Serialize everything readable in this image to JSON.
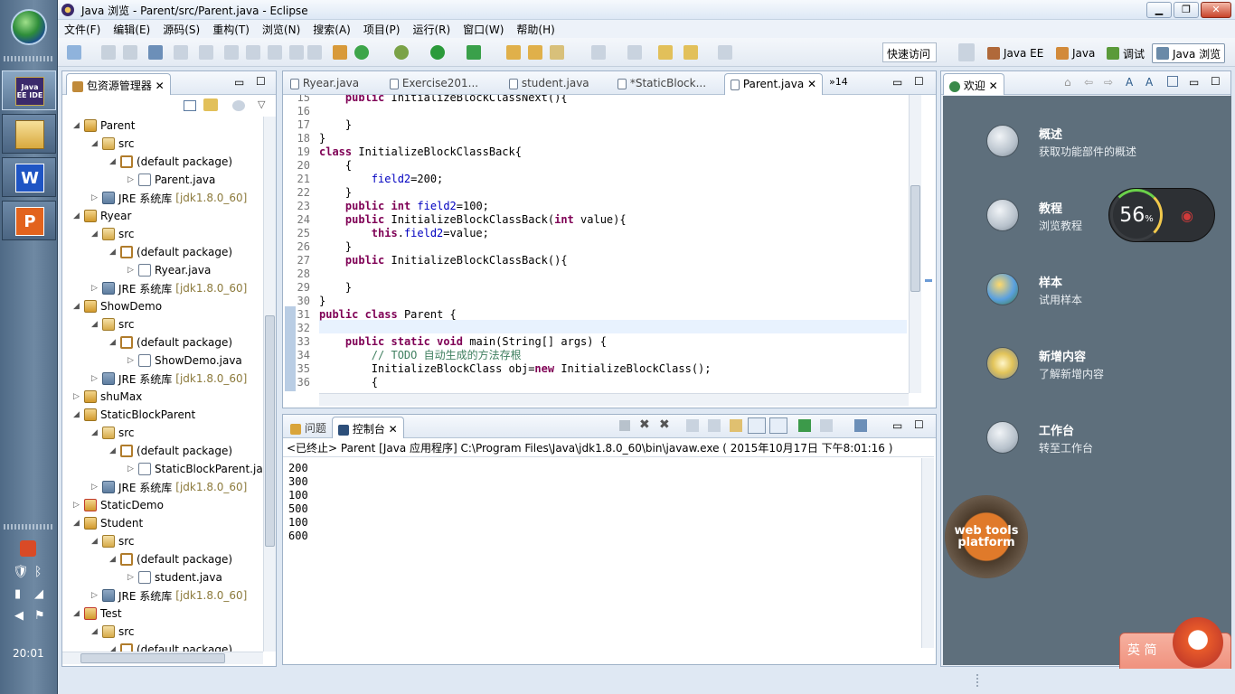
{
  "window": {
    "title": "Java 浏览 - Parent/src/Parent.java - Eclipse"
  },
  "taskbar": {
    "apps": [
      {
        "label": "Java EE IDE",
        "icon": "eclipse-icon"
      },
      {
        "label": "",
        "icon": "folder-icon"
      },
      {
        "label": "W",
        "icon": "wps-writer-icon"
      },
      {
        "label": "P",
        "icon": "wps-presentation-icon"
      }
    ],
    "clock": "20:01"
  },
  "menu": [
    "文件(F)",
    "编辑(E)",
    "源码(S)",
    "重构(T)",
    "浏览(N)",
    "搜索(A)",
    "项目(P)",
    "运行(R)",
    "窗口(W)",
    "帮助(H)"
  ],
  "quick_access": "快速访问",
  "perspectives": [
    "Java EE",
    "Java",
    "调试",
    "Java 浏览"
  ],
  "package_explorer": {
    "title": "包资源管理器",
    "rows": [
      {
        "indent": 0,
        "twisty": "◢",
        "icon": "proj",
        "label": "Parent"
      },
      {
        "indent": 1,
        "twisty": "◢",
        "icon": "src",
        "label": "src"
      },
      {
        "indent": 2,
        "twisty": "◢",
        "icon": "pkg",
        "label": "(default package)"
      },
      {
        "indent": 3,
        "twisty": "▷",
        "icon": "jfile",
        "label": "Parent.java"
      },
      {
        "indent": 1,
        "twisty": "▷",
        "icon": "jre",
        "label": "JRE 系统库",
        "ver": "[jdk1.8.0_60]"
      },
      {
        "indent": 0,
        "twisty": "◢",
        "icon": "proj",
        "label": "Ryear"
      },
      {
        "indent": 1,
        "twisty": "◢",
        "icon": "src",
        "label": "src"
      },
      {
        "indent": 2,
        "twisty": "◢",
        "icon": "pkg",
        "label": "(default package)"
      },
      {
        "indent": 3,
        "twisty": "▷",
        "icon": "jfile",
        "label": "Ryear.java"
      },
      {
        "indent": 1,
        "twisty": "▷",
        "icon": "jre",
        "label": "JRE 系统库",
        "ver": "[jdk1.8.0_60]"
      },
      {
        "indent": 0,
        "twisty": "◢",
        "icon": "proj",
        "label": "ShowDemo"
      },
      {
        "indent": 1,
        "twisty": "◢",
        "icon": "src",
        "label": "src"
      },
      {
        "indent": 2,
        "twisty": "◢",
        "icon": "pkg",
        "label": "(default package)"
      },
      {
        "indent": 3,
        "twisty": "▷",
        "icon": "jfile",
        "label": "ShowDemo.java"
      },
      {
        "indent": 1,
        "twisty": "▷",
        "icon": "jre",
        "label": "JRE 系统库",
        "ver": "[jdk1.8.0_60]"
      },
      {
        "indent": 0,
        "twisty": "▷",
        "icon": "proj",
        "label": "shuMax"
      },
      {
        "indent": 0,
        "twisty": "◢",
        "icon": "proj",
        "label": "StaticBlockParent"
      },
      {
        "indent": 1,
        "twisty": "◢",
        "icon": "src",
        "label": "src"
      },
      {
        "indent": 2,
        "twisty": "◢",
        "icon": "pkg",
        "label": "(default package)"
      },
      {
        "indent": 3,
        "twisty": "▷",
        "icon": "jfile",
        "label": "StaticBlockParent.jav"
      },
      {
        "indent": 1,
        "twisty": "▷",
        "icon": "jre",
        "label": "JRE 系统库",
        "ver": "[jdk1.8.0_60]"
      },
      {
        "indent": 0,
        "twisty": "▷",
        "icon": "err",
        "label": "StaticDemo"
      },
      {
        "indent": 0,
        "twisty": "◢",
        "icon": "proj",
        "label": "Student"
      },
      {
        "indent": 1,
        "twisty": "◢",
        "icon": "src",
        "label": "src"
      },
      {
        "indent": 2,
        "twisty": "◢",
        "icon": "pkg",
        "label": "(default package)"
      },
      {
        "indent": 3,
        "twisty": "▷",
        "icon": "jfile",
        "label": "student.java"
      },
      {
        "indent": 1,
        "twisty": "▷",
        "icon": "jre",
        "label": "JRE 系统库",
        "ver": "[jdk1.8.0_60]"
      },
      {
        "indent": 0,
        "twisty": "◢",
        "icon": "err",
        "label": "Test"
      },
      {
        "indent": 1,
        "twisty": "◢",
        "icon": "src",
        "label": "src"
      },
      {
        "indent": 2,
        "twisty": "◢",
        "icon": "pkg",
        "label": "(default package)"
      }
    ]
  },
  "editor": {
    "tabs": [
      {
        "label": "Ryear.java",
        "active": false
      },
      {
        "label": "Exercise201...",
        "active": false
      },
      {
        "label": "student.java",
        "active": false
      },
      {
        "label": "*StaticBlock...",
        "active": false
      },
      {
        "label": "Parent.java",
        "active": true
      }
    ],
    "overflow": "»14",
    "lines": [
      {
        "n": "15",
        "html": "    <span class='kw'>public</span> InitializeBlockClassNext(){"
      },
      {
        "n": "16",
        "html": ""
      },
      {
        "n": "17",
        "html": "    }"
      },
      {
        "n": "18",
        "html": "}"
      },
      {
        "n": "19",
        "html": "<span class='kw'>class</span> InitializeBlockClassBack{"
      },
      {
        "n": "20",
        "html": "    {"
      },
      {
        "n": "21",
        "html": "        <span class='fd'>field2</span>=200;"
      },
      {
        "n": "22",
        "html": "    }"
      },
      {
        "n": "23",
        "html": "    <span class='kw'>public</span> <span class='kw'>int</span> <span class='fd'>field2</span>=100;"
      },
      {
        "n": "24",
        "html": "    <span class='kw'>public</span> InitializeBlockClassBack(<span class='kw'>int</span> value){"
      },
      {
        "n": "25",
        "html": "        <span class='kw'>this</span>.<span class='fd'>field2</span>=value;"
      },
      {
        "n": "26",
        "html": "    }"
      },
      {
        "n": "27",
        "html": "    <span class='kw'>public</span> InitializeBlockClassBack(){"
      },
      {
        "n": "28",
        "html": ""
      },
      {
        "n": "29",
        "html": "    }"
      },
      {
        "n": "30",
        "html": "}"
      },
      {
        "n": "31",
        "html": "<span class='kw'>public</span> <span class='kw'>class</span> Parent {"
      },
      {
        "n": "32",
        "html": ""
      },
      {
        "n": "33",
        "html": "    <span class='kw'>public</span> <span class='kw'>static</span> <span class='kw'>void</span> main(String[] args) {"
      },
      {
        "n": "34",
        "html": "        <span class='cm'>// TODO 自动生成的方法存根</span>"
      },
      {
        "n": "35",
        "html": "        InitializeBlockClass obj=<span class='kw'>new</span> InitializeBlockClass();"
      },
      {
        "n": "36",
        "html": "        {"
      }
    ]
  },
  "console": {
    "tabs": [
      {
        "label": "问题",
        "active": false
      },
      {
        "label": "控制台",
        "active": true
      }
    ],
    "header": "<已终止> Parent [Java 应用程序] C:\\Program Files\\Java\\jdk1.8.0_60\\bin\\javaw.exe ( 2015年10月17日 下午8:01:16 )",
    "output": [
      "200",
      "300",
      "100",
      "500",
      "100",
      "600"
    ]
  },
  "welcome": {
    "tab": "欢迎",
    "items": [
      {
        "title": "概述",
        "sub": "获取功能部件的概述"
      },
      {
        "title": "教程",
        "sub": "浏览教程"
      },
      {
        "title": "样本",
        "sub": "试用样本"
      },
      {
        "title": "新增内容",
        "sub": "了解新增内容"
      },
      {
        "title": "工作台",
        "sub": "转至工作台"
      }
    ],
    "gauge": {
      "value": "56",
      "unit": "%"
    },
    "badge": "web tools platform"
  },
  "ime": {
    "label": "英 简"
  }
}
